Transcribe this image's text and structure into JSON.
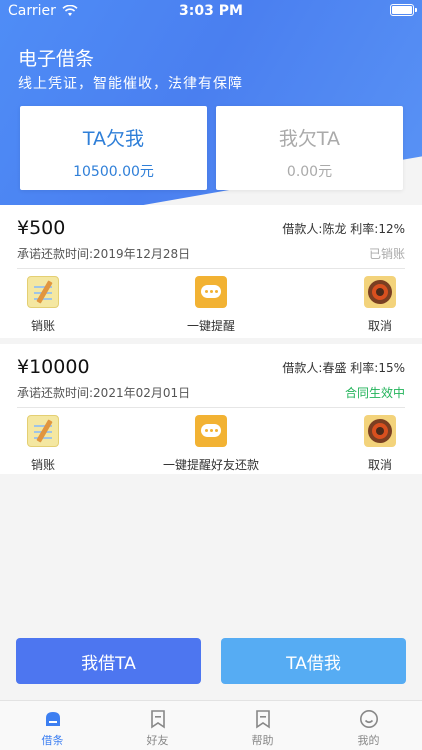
{
  "status_bar": {
    "carrier": "Carrier",
    "time": "3:03 PM"
  },
  "header": {
    "title": "电子借条",
    "subtitle": "线上凭证，智能催收，法律有保障"
  },
  "summary": {
    "owe_me": {
      "title": "TA欠我",
      "amount": "10500.00元"
    },
    "i_owe": {
      "title": "我欠TA",
      "amount": "0.00元"
    }
  },
  "loans": [
    {
      "amount": "¥500",
      "meta": "借款人:陈龙  利率:12%",
      "date": "承诺还款时间:2019年12月28日",
      "status": "已销账",
      "actions": [
        "销账",
        "一键提醒",
        "取消"
      ]
    },
    {
      "amount": "¥10000",
      "meta": "借款人:春盛  利率:15%",
      "date": "承诺还款时间:2021年02月01日",
      "status": "合同生效中",
      "actions": [
        "销账",
        "一键提醒好友还款",
        "取消"
      ]
    }
  ],
  "buttons": {
    "borrow": "我借TA",
    "lend": "TA借我"
  },
  "tabs": [
    "借条",
    "好友",
    "帮助",
    "我的"
  ],
  "colors": {
    "accent": "#3d7ff1",
    "status_active": "#22b35a",
    "status_cleared": "#aaaaaa"
  }
}
